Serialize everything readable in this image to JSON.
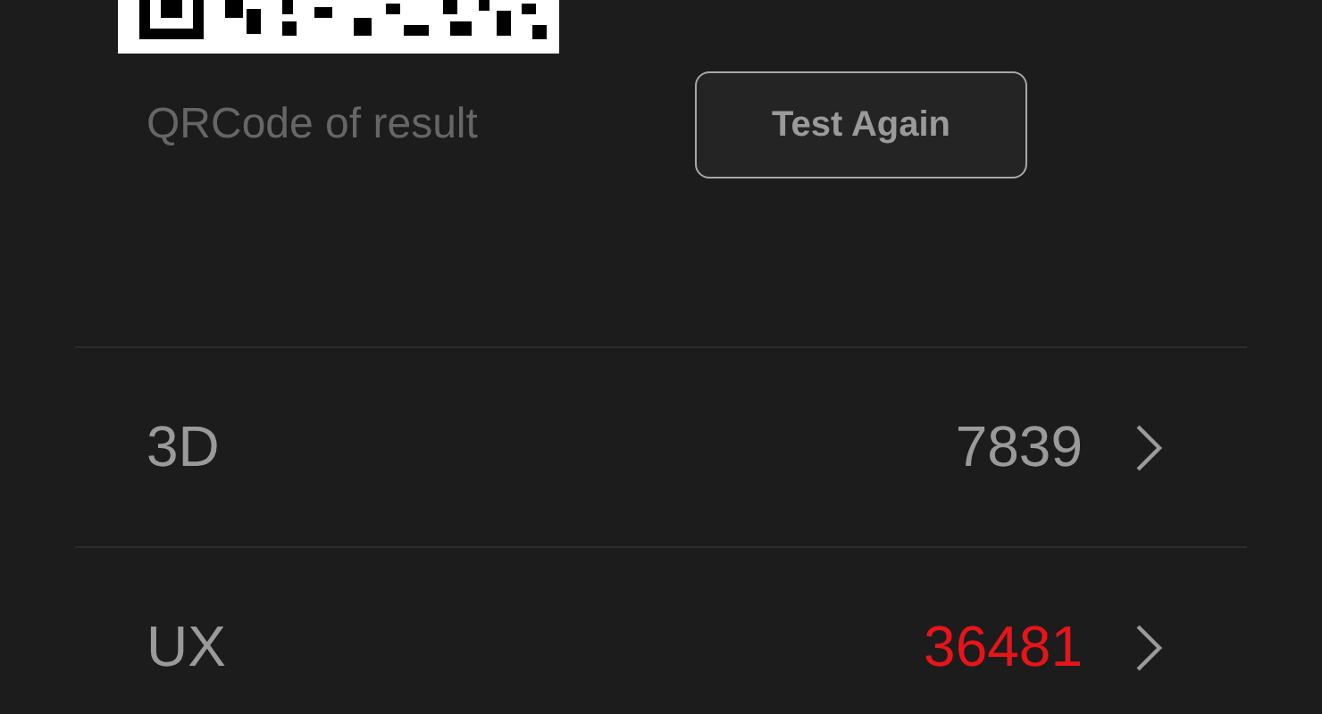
{
  "qr_caption": "QRCode of result",
  "test_again_button": {
    "label": "Test Again"
  },
  "scores": [
    {
      "label": "3D",
      "value": "7839",
      "color": "#9a9a9a"
    },
    {
      "label": "UX",
      "value": "36481",
      "color": "#e8141a"
    }
  ]
}
